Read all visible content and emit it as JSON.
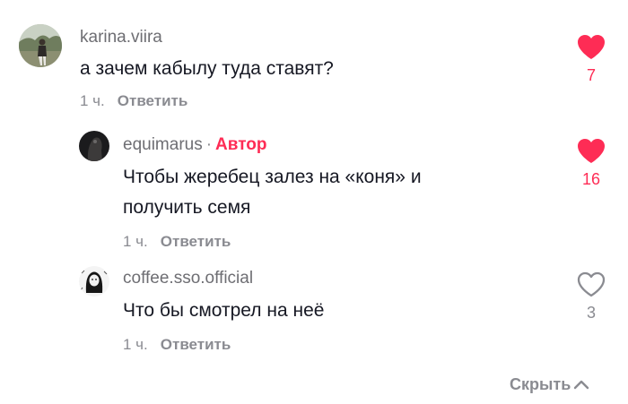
{
  "colors": {
    "accent": "#fe2c55",
    "muted": "#8a8b91",
    "text": "#161823"
  },
  "comments": [
    {
      "username": "karina.viira",
      "text": "а зачем кабылу туда ставят?",
      "time": "1 ч.",
      "reply_label": "Ответить",
      "likes": "7",
      "liked": true,
      "avatar_icon": "avatar-photo-outdoor"
    },
    {
      "username": "equimarus",
      "separator": "·",
      "badge": "Автор",
      "text_lines": [
        "Чтобы жеребец залез на «коня» и",
        "получить семя"
      ],
      "time": "1 ч.",
      "reply_label": "Ответить",
      "likes": "16",
      "liked": true,
      "avatar_icon": "avatar-photo-dark"
    },
    {
      "username": "coffee.sso.official",
      "text": "Что бы смотрел на неё",
      "time": "1 ч.",
      "reply_label": "Ответить",
      "likes": "3",
      "liked": false,
      "avatar_icon": "avatar-drawing"
    }
  ],
  "hide_label": "Скрыть",
  "hide_icon": "chevron-up-icon"
}
